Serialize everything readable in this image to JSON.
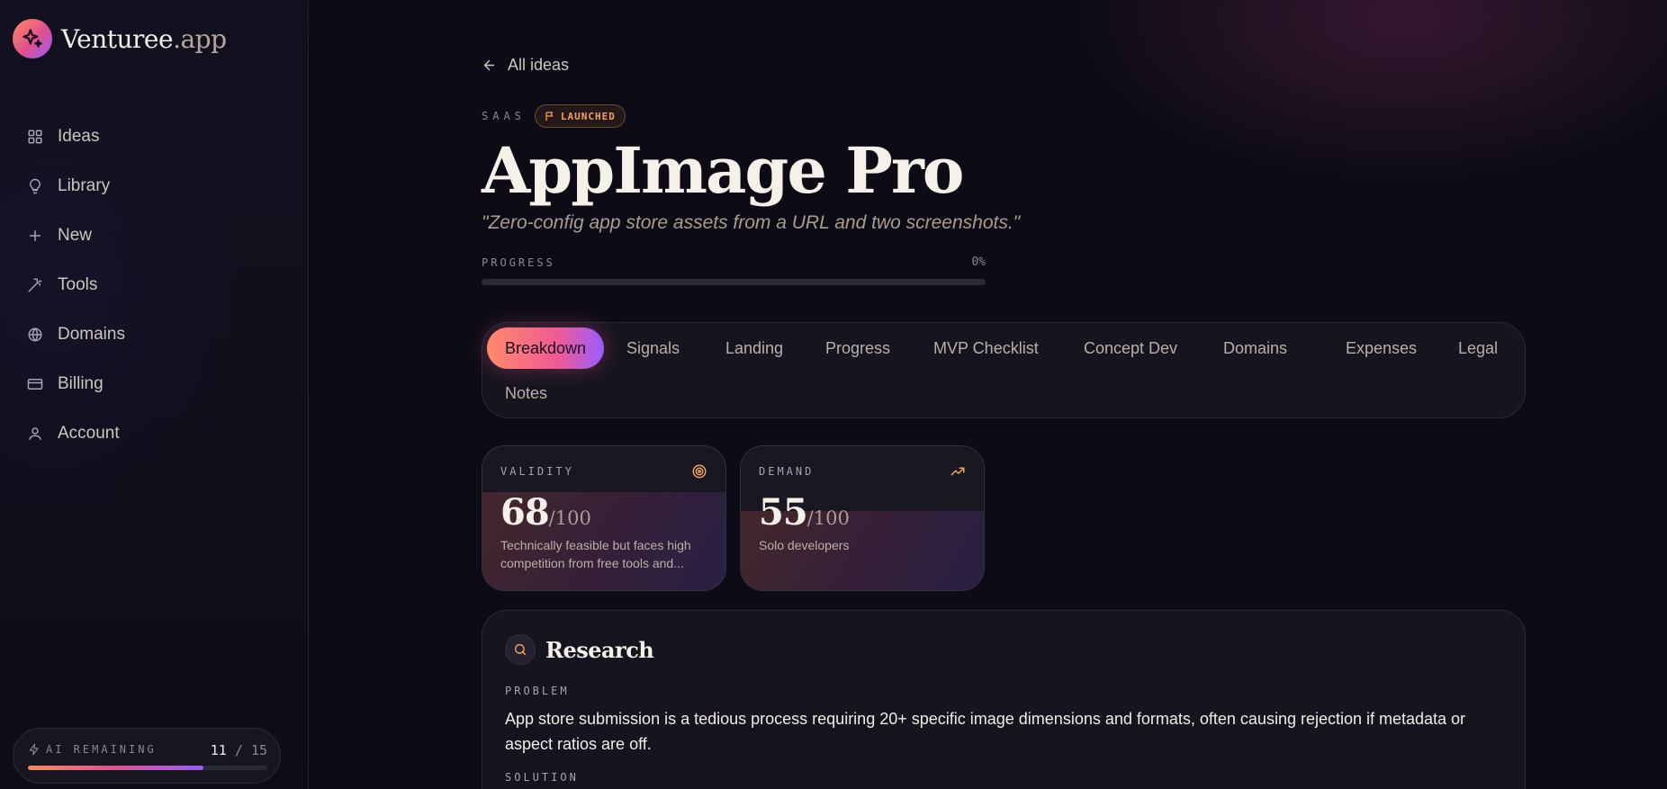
{
  "brand": {
    "name": "Venturee",
    "tld": ".app"
  },
  "sidebar": {
    "items": [
      {
        "label": "Ideas",
        "icon": "grid-icon"
      },
      {
        "label": "Library",
        "icon": "lightbulb-icon"
      },
      {
        "label": "New",
        "icon": "plus-icon"
      },
      {
        "label": "Tools",
        "icon": "wand-icon"
      },
      {
        "label": "Domains",
        "icon": "globe-icon"
      },
      {
        "label": "Billing",
        "icon": "credit-card-icon"
      },
      {
        "label": "Account",
        "icon": "user-icon"
      }
    ],
    "ai": {
      "label": "AI REMAINING",
      "used": "11",
      "separator": "/",
      "total": "15",
      "fraction": 0.7333
    }
  },
  "main": {
    "back_label": "All ideas",
    "category": "SAAS",
    "status": "LAUNCHED",
    "title": "AppImage Pro",
    "tagline": "\"Zero-config app store assets from a URL and two screenshots.\"",
    "progress": {
      "label": "PROGRESS",
      "value_text": "0%",
      "value": 0
    },
    "tabs": [
      {
        "label": "Breakdown",
        "active": true
      },
      {
        "label": "Signals"
      },
      {
        "label": "Landing"
      },
      {
        "label": "Progress"
      },
      {
        "label": "MVP Checklist"
      },
      {
        "label": "Concept Dev"
      },
      {
        "label": "Domains"
      },
      {
        "label": "Expenses"
      },
      {
        "label": "Legal"
      },
      {
        "label": "Notes"
      }
    ],
    "cards": [
      {
        "label": "VALIDITY",
        "score": "68",
        "out_of": "/100",
        "desc": "Technically feasible but faces high competition from free tools and...",
        "icon": "target-icon"
      },
      {
        "label": "DEMAND",
        "score": "55",
        "out_of": "/100",
        "desc": "Solo developers",
        "icon": "trending-up-icon"
      }
    ],
    "research": {
      "title": "Research",
      "problem_label": "PROBLEM",
      "problem": "App store submission is a tedious process requiring 20+ specific image dimensions and formats, often causing rejection if metadata or aspect ratios are off.",
      "solution_label": "SOLUTION"
    }
  },
  "colors": {
    "accent_orange": "#f0a35c",
    "gradient_start": "#ff8a5c",
    "gradient_mid": "#e0508f",
    "gradient_end": "#9a5cff",
    "background": "#0d0c16"
  }
}
